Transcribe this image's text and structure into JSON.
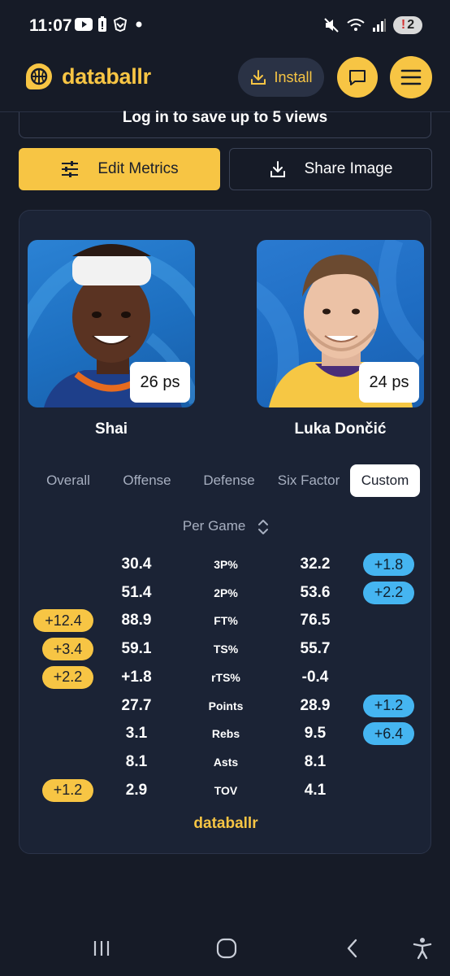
{
  "status_bar": {
    "time": "11:07",
    "notification_count": "2"
  },
  "header": {
    "brand_name": "databallr",
    "install_label": "Install"
  },
  "login_banner": "Log in to save up to 5 views",
  "actions": {
    "edit_metrics": "Edit Metrics",
    "share_image": "Share Image"
  },
  "players": [
    {
      "name": "Shai",
      "badge": "26 ps"
    },
    {
      "name": "Luka Dončić",
      "badge": "24 ps"
    }
  ],
  "tabs": [
    "Overall",
    "Offense",
    "Defense",
    "Six Factor",
    "Custom"
  ],
  "active_tab": "Custom",
  "mode": "Per Game",
  "stats": [
    {
      "label": "3P%",
      "left": "30.4",
      "right": "32.2",
      "left_diff": "",
      "right_diff": "+1.8"
    },
    {
      "label": "2P%",
      "left": "51.4",
      "right": "53.6",
      "left_diff": "",
      "right_diff": "+2.2"
    },
    {
      "label": "FT%",
      "left": "88.9",
      "right": "76.5",
      "left_diff": "+12.4",
      "right_diff": ""
    },
    {
      "label": "TS%",
      "left": "59.1",
      "right": "55.7",
      "left_diff": "+3.4",
      "right_diff": ""
    },
    {
      "label": "rTS%",
      "left": "+1.8",
      "right": "-0.4",
      "left_diff": "+2.2",
      "right_diff": ""
    },
    {
      "label": "Points",
      "left": "27.7",
      "right": "28.9",
      "left_diff": "",
      "right_diff": "+1.2"
    },
    {
      "label": "Rebs",
      "left": "3.1",
      "right": "9.5",
      "left_diff": "",
      "right_diff": "+6.4"
    },
    {
      "label": "Asts",
      "left": "8.1",
      "right": "8.1",
      "left_diff": "",
      "right_diff": ""
    },
    {
      "label": "TOV",
      "left": "2.9",
      "right": "4.1",
      "left_diff": "+1.2",
      "right_diff": ""
    }
  ],
  "footer_brand": "databallr",
  "colors": {
    "background": "#161b27",
    "card": "#1b2335",
    "accent_yellow": "#f7c544",
    "accent_blue": "#45b5f1"
  },
  "icons": {
    "status_left": [
      "youtube-icon",
      "battery-saver-icon",
      "app-icon",
      "dot-icon"
    ],
    "status_right": [
      "mute-icon",
      "wifi-icon",
      "signal-icon"
    ],
    "nav": [
      "recents-icon",
      "home-icon",
      "back-icon",
      "accessibility-icon"
    ]
  }
}
